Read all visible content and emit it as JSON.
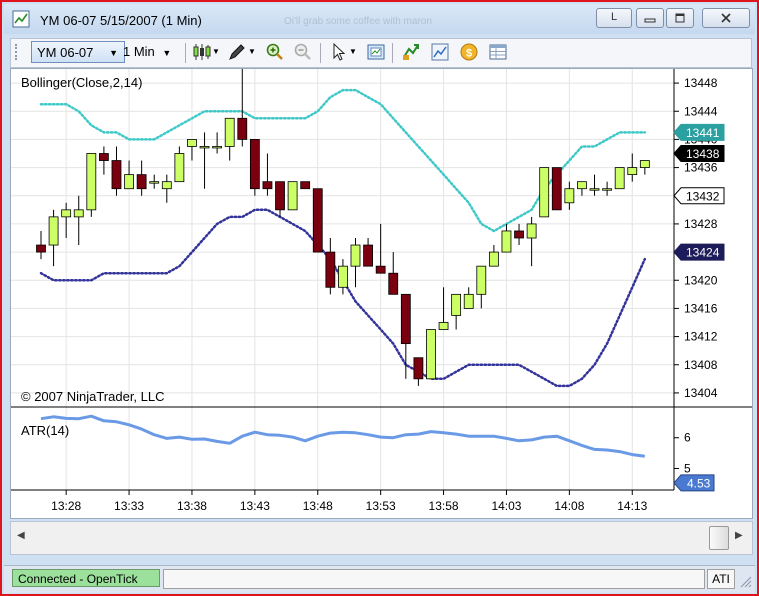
{
  "window": {
    "title": "YM 06-07  5/15/2007  (1 Min)",
    "title_overlay": "Oi'll grab some coffee with maron",
    "buttons": {
      "link": "L",
      "minimize": "minimize",
      "maximize": "maximize",
      "close": "close"
    }
  },
  "toolbar": {
    "instrument": "YM 06-07",
    "period": "1 Min",
    "icons": [
      "candlestick-style-icon",
      "drawing-pencil-icon",
      "zoom-in-icon",
      "zoom-out-icon",
      "cursor-pointer-icon",
      "properties-icon",
      "strategy-icon",
      "chart-indicator-icon",
      "dollar-coin-icon",
      "data-grid-icon"
    ]
  },
  "price_panel": {
    "indicator_label": "Bollinger(Close,2,14)",
    "copyright": "© 2007 NinjaTrader, LLC",
    "markers": {
      "upper_band_value": "13441",
      "last_price": "13438",
      "open_box": "13432",
      "lower_band_value": "13424"
    },
    "colors": {
      "up": "#ccff66",
      "down": "#7a0010",
      "upper_band": "#3ec8c8",
      "lower_band": "#333399",
      "marker_upper": "#2aa0a0",
      "marker_last": "#000000",
      "marker_lower": "#1c1c5a"
    }
  },
  "atr_panel": {
    "indicator_label": "ATR(14)",
    "last_value": "4.53",
    "color": "#6a9ae6"
  },
  "status_bar": {
    "connection": "Connected - OpenTick",
    "field": "",
    "ati": "ATI"
  },
  "chart_data": [
    {
      "type": "candlestick",
      "title": "Bollinger(Close,2,14)",
      "x": [
        "13:26",
        "13:27",
        "13:28",
        "13:29",
        "13:30",
        "13:31",
        "13:32",
        "13:33",
        "13:34",
        "13:35",
        "13:36",
        "13:37",
        "13:38",
        "13:39",
        "13:40",
        "13:41",
        "13:42",
        "13:43",
        "13:44",
        "13:45",
        "13:46",
        "13:47",
        "13:48",
        "13:49",
        "13:50",
        "13:51",
        "13:52",
        "13:53",
        "13:54",
        "13:55",
        "13:56",
        "13:57",
        "13:58",
        "13:59",
        "14:00",
        "14:01",
        "14:02",
        "14:03",
        "14:04",
        "14:05",
        "14:06",
        "14:07",
        "14:08",
        "14:09",
        "14:10",
        "14:11",
        "14:12",
        "14:13",
        "14:14"
      ],
      "x_ticks": [
        "13:28",
        "13:33",
        "13:38",
        "13:43",
        "13:48",
        "13:53",
        "13:58",
        "14:03",
        "14:08",
        "14:13"
      ],
      "ylim": [
        13402,
        13450
      ],
      "y_ticks": [
        13404,
        13408,
        13412,
        13416,
        13420,
        13424,
        13428,
        13432,
        13436,
        13440,
        13444,
        13448
      ],
      "candles": [
        {
          "o": 13425,
          "h": 13427,
          "l": 13423,
          "c": 13424
        },
        {
          "o": 13425,
          "h": 13430,
          "l": 13422,
          "c": 13429
        },
        {
          "o": 13429,
          "h": 13431,
          "l": 13426,
          "c": 13430
        },
        {
          "o": 13429,
          "h": 13432,
          "l": 13425,
          "c": 13430
        },
        {
          "o": 13430,
          "h": 13438,
          "l": 13429,
          "c": 13438
        },
        {
          "o": 13438,
          "h": 13439,
          "l": 13435,
          "c": 13437
        },
        {
          "o": 13437,
          "h": 13439,
          "l": 13432,
          "c": 13433
        },
        {
          "o": 13433,
          "h": 13437,
          "l": 13433,
          "c": 13435
        },
        {
          "o": 13435,
          "h": 13437,
          "l": 13432,
          "c": 13433
        },
        {
          "o": 13434,
          "h": 13435,
          "l": 13433,
          "c": 13434
        },
        {
          "o": 13433,
          "h": 13435,
          "l": 13431,
          "c": 13434
        },
        {
          "o": 13434,
          "h": 13439,
          "l": 13434,
          "c": 13438
        },
        {
          "o": 13439,
          "h": 13440,
          "l": 13437,
          "c": 13440
        },
        {
          "o": 13439,
          "h": 13441,
          "l": 13433,
          "c": 13439
        },
        {
          "o": 13439,
          "h": 13441,
          "l": 13438,
          "c": 13439
        },
        {
          "o": 13439,
          "h": 13443,
          "l": 13437,
          "c": 13443
        },
        {
          "o": 13443,
          "h": 13450,
          "l": 13439,
          "c": 13440
        },
        {
          "o": 13440,
          "h": 13440,
          "l": 13432,
          "c": 13433
        },
        {
          "o": 13434,
          "h": 13438,
          "l": 13432,
          "c": 13433
        },
        {
          "o": 13434,
          "h": 13434,
          "l": 13429,
          "c": 13430
        },
        {
          "o": 13430,
          "h": 13434,
          "l": 13430,
          "c": 13434
        },
        {
          "o": 13434,
          "h": 13434,
          "l": 13433,
          "c": 13433
        },
        {
          "o": 13433,
          "h": 13433,
          "l": 13424,
          "c": 13424
        },
        {
          "o": 13424,
          "h": 13426,
          "l": 13418,
          "c": 13419
        },
        {
          "o": 13419,
          "h": 13423,
          "l": 13418,
          "c": 13422
        },
        {
          "o": 13422,
          "h": 13426,
          "l": 13419,
          "c": 13425
        },
        {
          "o": 13425,
          "h": 13426,
          "l": 13422,
          "c": 13422
        },
        {
          "o": 13422,
          "h": 13428,
          "l": 13421,
          "c": 13421
        },
        {
          "o": 13421,
          "h": 13424,
          "l": 13418,
          "c": 13418
        },
        {
          "o": 13418,
          "h": 13418,
          "l": 13406,
          "c": 13411
        },
        {
          "o": 13409,
          "h": 13409,
          "l": 13405,
          "c": 13406
        },
        {
          "o": 13406,
          "h": 13413,
          "l": 13406,
          "c": 13413
        },
        {
          "o": 13413,
          "h": 13419,
          "l": 13413,
          "c": 13414
        },
        {
          "o": 13415,
          "h": 13418,
          "l": 13413,
          "c": 13418
        },
        {
          "o": 13416,
          "h": 13419,
          "l": 13416,
          "c": 13418
        },
        {
          "o": 13418,
          "h": 13422,
          "l": 13416,
          "c": 13422
        },
        {
          "o": 13422,
          "h": 13425,
          "l": 13422,
          "c": 13424
        },
        {
          "o": 13424,
          "h": 13428,
          "l": 13424,
          "c": 13427
        },
        {
          "o": 13427,
          "h": 13428,
          "l": 13425,
          "c": 13426
        },
        {
          "o": 13426,
          "h": 13429,
          "l": 13422,
          "c": 13428
        },
        {
          "o": 13429,
          "h": 13436,
          "l": 13429,
          "c": 13436
        },
        {
          "o": 13436,
          "h": 13436,
          "l": 13430,
          "c": 13430
        },
        {
          "o": 13431,
          "h": 13434,
          "l": 13430,
          "c": 13433
        },
        {
          "o": 13433,
          "h": 13434,
          "l": 13432,
          "c": 13434
        },
        {
          "o": 13433,
          "h": 13435,
          "l": 13432,
          "c": 13433
        },
        {
          "o": 13433,
          "h": 13434,
          "l": 13432,
          "c": 13433
        },
        {
          "o": 13433,
          "h": 13436,
          "l": 13433,
          "c": 13436
        },
        {
          "o": 13435,
          "h": 13438,
          "l": 13434,
          "c": 13436
        },
        {
          "o": 13436,
          "h": 13437,
          "l": 13435,
          "c": 13437
        }
      ],
      "series": [
        {
          "name": "Upper band",
          "values": [
            13445,
            13445,
            13445,
            13444,
            13442,
            13441,
            13441,
            13440,
            13440,
            13440,
            13441,
            13442,
            13443,
            13444,
            13444,
            13444,
            13444,
            13443,
            13443,
            13443,
            13443,
            13443,
            13444,
            13446,
            13447,
            13447,
            13446,
            13445,
            13443,
            13441,
            13439,
            13437,
            13435,
            13433,
            13431,
            13428,
            13427,
            13428,
            13429,
            13430,
            13433,
            13435,
            13437,
            13439,
            13439,
            13440,
            13441,
            13441,
            13441
          ]
        },
        {
          "name": "Lower band",
          "values": [
            13421,
            13420,
            13420,
            13420,
            13420,
            13421,
            13421,
            13421,
            13421,
            13421,
            13421,
            13422,
            13424,
            13426,
            13428,
            13429,
            13429,
            13430,
            13430,
            13429,
            13428,
            13427,
            13425,
            13423,
            13420,
            13417,
            13415,
            13413,
            13411,
            13408,
            13407,
            13406,
            13406,
            13407,
            13408,
            13408,
            13408,
            13408,
            13408,
            13407,
            13406,
            13405,
            13405,
            13406,
            13408,
            13411,
            13415,
            13419,
            13423
          ]
        }
      ]
    },
    {
      "type": "line",
      "title": "ATR(14)",
      "x_ticks": [
        "13:28",
        "13:33",
        "13:38",
        "13:43",
        "13:48",
        "13:53",
        "13:58",
        "14:03",
        "14:08",
        "14:13"
      ],
      "ylim": [
        4.3,
        7.0
      ],
      "y_ticks": [
        5,
        6
      ],
      "series": [
        {
          "name": "ATR(14)",
          "values": [
            6.62,
            6.68,
            6.63,
            6.62,
            6.7,
            6.55,
            6.52,
            6.42,
            6.28,
            6.1,
            5.98,
            6.02,
            5.95,
            5.96,
            5.88,
            5.82,
            6.05,
            6.18,
            6.1,
            6.08,
            6.02,
            5.9,
            6.05,
            6.15,
            6.18,
            6.16,
            6.1,
            6.02,
            6.0,
            6.1,
            6.12,
            6.2,
            6.16,
            6.12,
            6.05,
            6.05,
            6.05,
            5.98,
            5.9,
            5.93,
            6.02,
            6.05,
            5.9,
            5.75,
            5.62,
            5.6,
            5.55,
            5.45,
            5.4
          ]
        }
      ]
    }
  ]
}
